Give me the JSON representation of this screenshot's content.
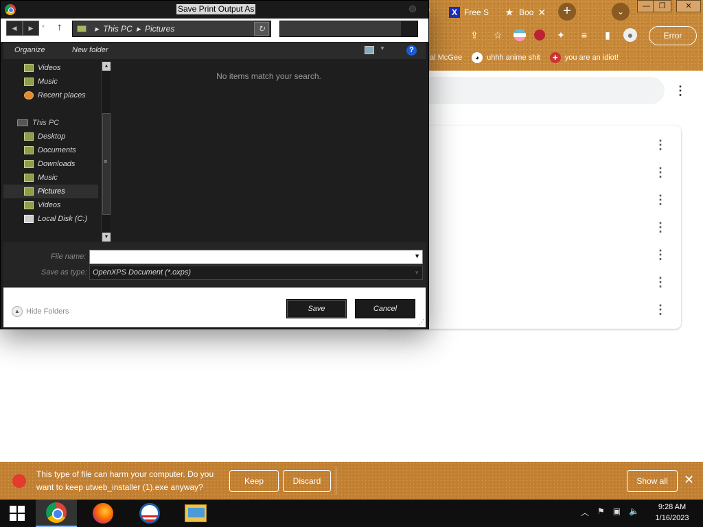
{
  "dialog": {
    "title": "Save Print Output As",
    "address": {
      "crumbs": [
        "This PC",
        "Pictures"
      ]
    },
    "toolbar": {
      "organize": "Organize",
      "new_folder": "New folder"
    },
    "nav_items": [
      {
        "label": "Videos",
        "icon": "videos-folder-icon",
        "type": "child"
      },
      {
        "label": "Music",
        "icon": "music-folder-icon",
        "type": "child"
      },
      {
        "label": "Recent places",
        "icon": "recent-places-icon",
        "type": "child"
      },
      {
        "label": "This PC",
        "icon": "this-pc-icon",
        "type": "section"
      },
      {
        "label": "Desktop",
        "icon": "desktop-folder-icon",
        "type": "child"
      },
      {
        "label": "Documents",
        "icon": "documents-folder-icon",
        "type": "child"
      },
      {
        "label": "Downloads",
        "icon": "downloads-folder-icon",
        "type": "child"
      },
      {
        "label": "Music",
        "icon": "music-folder-icon",
        "type": "child"
      },
      {
        "label": "Pictures",
        "icon": "pictures-folder-icon",
        "type": "child",
        "selected": true
      },
      {
        "label": "Videos",
        "icon": "videos-folder-icon",
        "type": "child"
      },
      {
        "label": "Local Disk (C:)",
        "icon": "drive-icon",
        "type": "child"
      }
    ],
    "empty_message": "No items match your search.",
    "file_name_label": "File name:",
    "file_name_value": "",
    "save_as_type_label": "Save as type:",
    "save_as_type_value": "OpenXPS Document (*.oxps)",
    "hide_folders": "Hide Folders",
    "save_label": "Save",
    "cancel_label": "Cancel"
  },
  "browser": {
    "tabs": [
      {
        "label": "Free S",
        "icon": "x-icon"
      },
      {
        "label": "Boo",
        "icon": "star-icon",
        "active": true
      }
    ],
    "error_button": "Error",
    "bookmarks": [
      {
        "label": "al McGee"
      },
      {
        "label": "uhhh anime shit"
      },
      {
        "label": "you are an idiot!"
      }
    ]
  },
  "download_bar": {
    "message": "This type of file can harm your computer. Do you want to keep utweb_installer (1).exe anyway?",
    "keep": "Keep",
    "discard": "Discard",
    "show_all": "Show all"
  },
  "taskbar": {
    "time": "9:28 AM",
    "date": "1/16/2023"
  },
  "colors": {
    "chrome_theme": "#c68838",
    "dialog_bg": "#1f1f1f",
    "download_bar": "#c17f32",
    "warning_icon": "#e33b2e"
  }
}
